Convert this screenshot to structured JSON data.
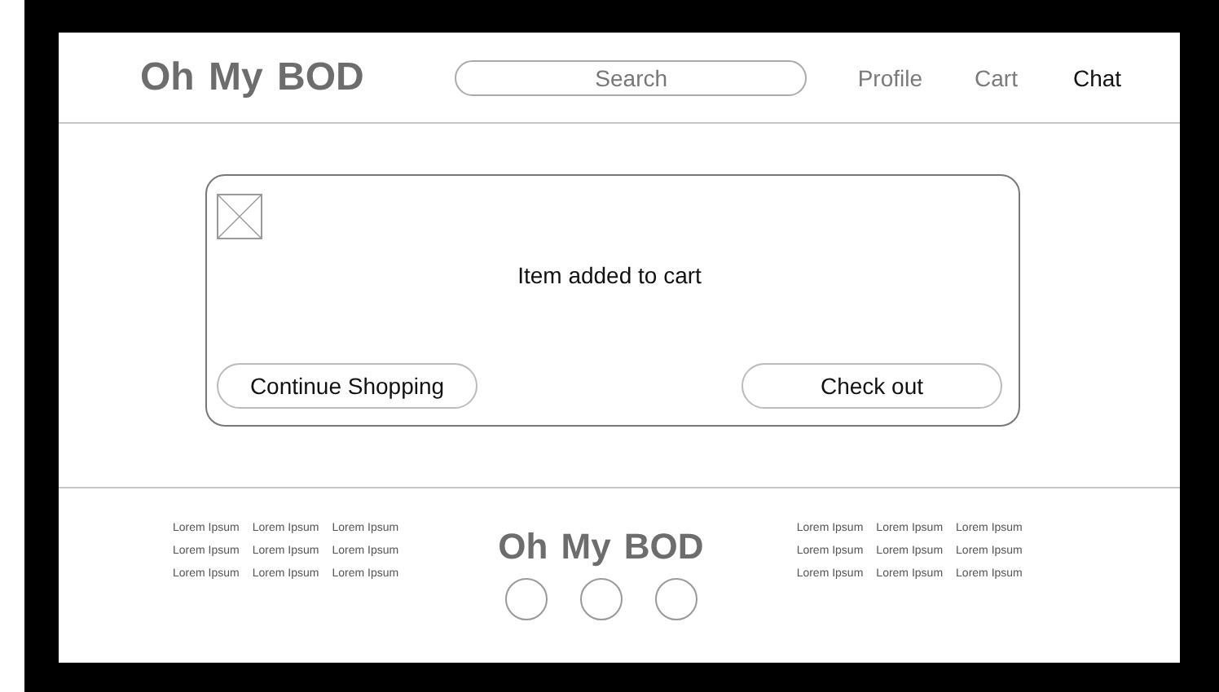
{
  "header": {
    "logo": "Oh My BOD",
    "search": {
      "placeholder": "Search"
    },
    "nav": [
      {
        "label": "Profile",
        "selected": false
      },
      {
        "label": "Cart",
        "selected": false
      },
      {
        "label": "Chat",
        "selected": true
      }
    ]
  },
  "dialog": {
    "message": "Item added to cart",
    "buttons": [
      "Continue Shopping",
      "Check out"
    ]
  },
  "footer": {
    "left_links": [
      [
        "Lorem Ipsum",
        "Lorem Ipsum",
        "Lorem Ipsum"
      ],
      [
        "Lorem Ipsum",
        "Lorem Ipsum",
        "Lorem Ipsum"
      ],
      [
        "Lorem Ipsum",
        "Lorem Ipsum",
        "Lorem Ipsum"
      ]
    ],
    "logo": "Oh My BOD",
    "social_icons": [
      {
        "kind": "circle"
      },
      {
        "kind": "circle"
      },
      {
        "kind": "circle"
      }
    ],
    "right_links": [
      [
        "Lorem Ipsum",
        "Lorem Ipsum",
        "Lorem Ipsum"
      ],
      [
        "Lorem Ipsum",
        "Lorem Ipsum",
        "Lorem Ipsum"
      ],
      [
        "Lorem Ipsum",
        "Lorem Ipsum",
        "Lorem Ipsum"
      ]
    ]
  }
}
